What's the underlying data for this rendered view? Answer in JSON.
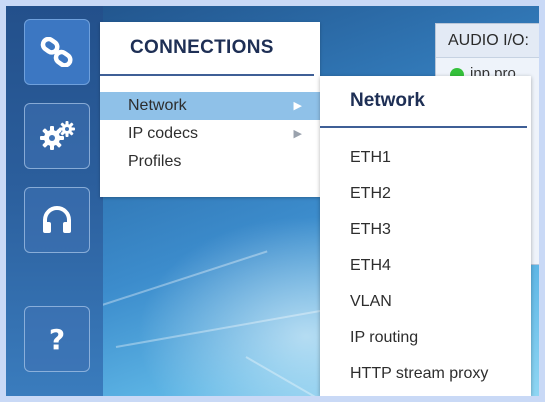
{
  "sidebar": {
    "buttons": [
      {
        "name": "connections",
        "icon": "link-icon",
        "active": true
      },
      {
        "name": "settings",
        "icon": "gears-icon",
        "active": false
      },
      {
        "name": "audio",
        "icon": "headphones-icon",
        "active": false
      },
      {
        "name": "help",
        "icon": "question-icon",
        "label": "?",
        "active": false
      }
    ]
  },
  "audio_panel": {
    "title": "AUDIO I/O:",
    "status_color": "#35c13b",
    "status_text": "inp pro"
  },
  "menu_connections": {
    "title": "CONNECTIONS",
    "items": [
      {
        "label": "Network",
        "has_submenu": true,
        "active": true
      },
      {
        "label": "IP codecs",
        "has_submenu": true,
        "active": false
      },
      {
        "label": "Profiles",
        "has_submenu": false,
        "active": false
      }
    ],
    "arrow_glyph": "▶"
  },
  "menu_network": {
    "title": "Network",
    "items": [
      "ETH1",
      "ETH2",
      "ETH3",
      "ETH4",
      "VLAN",
      "IP routing",
      "HTTP stream proxy"
    ]
  },
  "colors": {
    "menu_title": "#1e2f55",
    "active_item": "#8fc1e8",
    "sidebar": "#2b5e9c"
  }
}
